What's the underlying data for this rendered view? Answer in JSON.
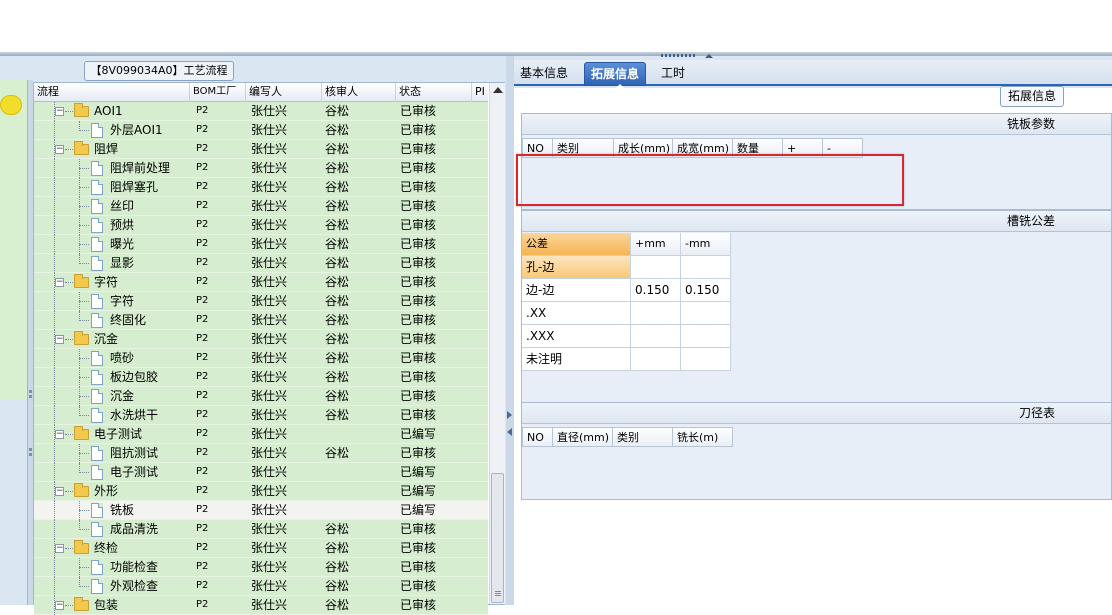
{
  "workflow_title": "【8V099034A0】工艺流程",
  "tree": {
    "headers": [
      "流程",
      "BOM工厂",
      "编写人",
      "核审人",
      "状态",
      "PI"
    ],
    "rows": [
      {
        "level": 1,
        "kind": "folder",
        "name": "AOI1",
        "bom": "P2",
        "writer": "张仕兴",
        "reviewer": "谷松",
        "status": "已审核"
      },
      {
        "level": 2,
        "kind": "doc",
        "name": "外层AOI1",
        "bom": "P2",
        "writer": "张仕兴",
        "reviewer": "谷松",
        "status": "已审核"
      },
      {
        "level": 1,
        "kind": "folder",
        "name": "阻焊",
        "bom": "P2",
        "writer": "张仕兴",
        "reviewer": "谷松",
        "status": "已审核"
      },
      {
        "level": 2,
        "kind": "doc",
        "name": "阻焊前处理",
        "bom": "P2",
        "writer": "张仕兴",
        "reviewer": "谷松",
        "status": "已审核"
      },
      {
        "level": 2,
        "kind": "doc",
        "name": "阻焊塞孔",
        "bom": "P2",
        "writer": "张仕兴",
        "reviewer": "谷松",
        "status": "已审核"
      },
      {
        "level": 2,
        "kind": "doc",
        "name": "丝印",
        "bom": "P2",
        "writer": "张仕兴",
        "reviewer": "谷松",
        "status": "已审核"
      },
      {
        "level": 2,
        "kind": "doc",
        "name": "预烘",
        "bom": "P2",
        "writer": "张仕兴",
        "reviewer": "谷松",
        "status": "已审核"
      },
      {
        "level": 2,
        "kind": "doc",
        "name": "曝光",
        "bom": "P2",
        "writer": "张仕兴",
        "reviewer": "谷松",
        "status": "已审核"
      },
      {
        "level": 2,
        "kind": "doc",
        "name": "显影",
        "bom": "P2",
        "writer": "张仕兴",
        "reviewer": "谷松",
        "status": "已审核"
      },
      {
        "level": 1,
        "kind": "folder",
        "name": "字符",
        "bom": "P2",
        "writer": "张仕兴",
        "reviewer": "谷松",
        "status": "已审核"
      },
      {
        "level": 2,
        "kind": "doc",
        "name": "字符",
        "bom": "P2",
        "writer": "张仕兴",
        "reviewer": "谷松",
        "status": "已审核"
      },
      {
        "level": 2,
        "kind": "doc",
        "name": "终固化",
        "bom": "P2",
        "writer": "张仕兴",
        "reviewer": "谷松",
        "status": "已审核"
      },
      {
        "level": 1,
        "kind": "folder",
        "name": "沉金",
        "bom": "P2",
        "writer": "张仕兴",
        "reviewer": "谷松",
        "status": "已审核"
      },
      {
        "level": 2,
        "kind": "doc",
        "name": "喷砂",
        "bom": "P2",
        "writer": "张仕兴",
        "reviewer": "谷松",
        "status": "已审核"
      },
      {
        "level": 2,
        "kind": "doc",
        "name": "板边包胶",
        "bom": "P2",
        "writer": "张仕兴",
        "reviewer": "谷松",
        "status": "已审核"
      },
      {
        "level": 2,
        "kind": "doc",
        "name": "沉金",
        "bom": "P2",
        "writer": "张仕兴",
        "reviewer": "谷松",
        "status": "已审核"
      },
      {
        "level": 2,
        "kind": "doc",
        "name": "水洗烘干",
        "bom": "P2",
        "writer": "张仕兴",
        "reviewer": "谷松",
        "status": "已审核"
      },
      {
        "level": 1,
        "kind": "folder",
        "name": "电子测试",
        "bom": "P2",
        "writer": "张仕兴",
        "reviewer": "",
        "status": "已编写"
      },
      {
        "level": 2,
        "kind": "doc",
        "name": "阻抗测试",
        "bom": "P2",
        "writer": "张仕兴",
        "reviewer": "谷松",
        "status": "已审核"
      },
      {
        "level": 2,
        "kind": "doc",
        "name": "电子测试",
        "bom": "P2",
        "writer": "张仕兴",
        "reviewer": "",
        "status": "已编写"
      },
      {
        "level": 1,
        "kind": "folder",
        "name": "外形",
        "bom": "P2",
        "writer": "张仕兴",
        "reviewer": "",
        "status": "已编写"
      },
      {
        "level": 2,
        "kind": "doc",
        "name": "铣板",
        "bom": "P2",
        "writer": "张仕兴",
        "reviewer": "",
        "status": "已编写",
        "selected": true
      },
      {
        "level": 2,
        "kind": "doc",
        "name": "成品清洗",
        "bom": "P2",
        "writer": "张仕兴",
        "reviewer": "谷松",
        "status": "已审核"
      },
      {
        "level": 1,
        "kind": "folder",
        "name": "终检",
        "bom": "P2",
        "writer": "张仕兴",
        "reviewer": "谷松",
        "status": "已审核"
      },
      {
        "level": 2,
        "kind": "doc",
        "name": "功能检查",
        "bom": "P2",
        "writer": "张仕兴",
        "reviewer": "谷松",
        "status": "已审核"
      },
      {
        "level": 2,
        "kind": "doc",
        "name": "外观检查",
        "bom": "P2",
        "writer": "张仕兴",
        "reviewer": "谷松",
        "status": "已审核"
      },
      {
        "level": 1,
        "kind": "folder",
        "name": "包装",
        "bom": "P2",
        "writer": "张仕兴",
        "reviewer": "谷松",
        "status": "已审核"
      }
    ]
  },
  "tabs": [
    "基本信息",
    "拓展信息",
    "工时"
  ],
  "active_tab": "拓展信息",
  "ext_button": "拓展信息",
  "mill_params": {
    "title": "铣板参数",
    "columns": [
      "NO",
      "类别",
      "成长(mm)",
      "成宽(mm)",
      "数量",
      "+",
      "-"
    ]
  },
  "slot_tolerance": {
    "title": "槽铣公差",
    "header": [
      "公差",
      "+mm",
      "-mm"
    ],
    "rows": [
      {
        "label": "孔-边",
        "plus": "",
        "minus": ""
      },
      {
        "label": "边-边",
        "plus": "0.150",
        "minus": "0.150"
      },
      {
        "label": ".XX",
        "plus": "",
        "minus": ""
      },
      {
        "label": ".XXX",
        "plus": "",
        "minus": ""
      },
      {
        "label": "未注明",
        "plus": "",
        "minus": ""
      }
    ]
  },
  "tool_table": {
    "title": "刀径表",
    "columns": [
      "NO",
      "直径(mm)",
      "类别",
      "铣长(m)"
    ]
  },
  "colors": {
    "row_bg": "#d6eecf",
    "tab_active": "#2f63b4",
    "highlight_box": "#d9272e",
    "tolerance_header": "#f5b553"
  }
}
